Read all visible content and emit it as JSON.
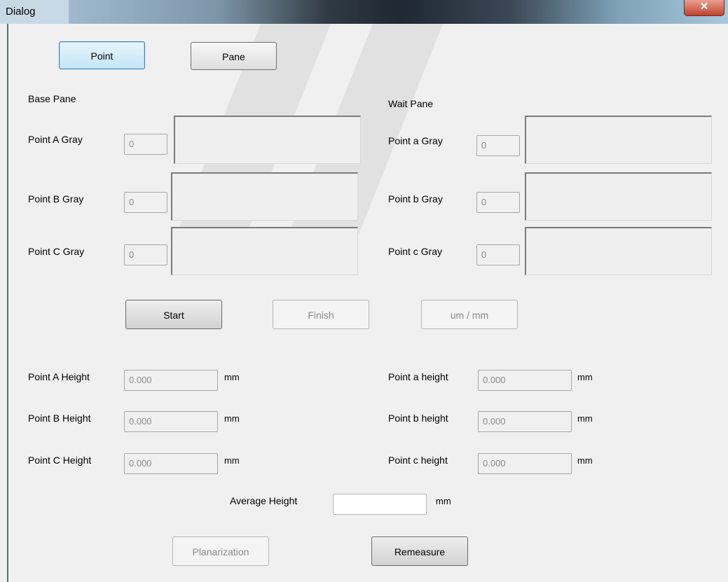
{
  "window": {
    "title": "Dialog",
    "close_glyph": "✕"
  },
  "mode_buttons": {
    "point": "Point",
    "pane": "Pane"
  },
  "base_pane": {
    "heading": "Base Pane",
    "rows": [
      {
        "label": "Point A Gray",
        "value": "0"
      },
      {
        "label": "Point B Gray",
        "value": "0"
      },
      {
        "label": "Point C Gray",
        "value": "0"
      }
    ]
  },
  "wait_pane": {
    "heading": "Wait Pane",
    "rows": [
      {
        "label": "Point a Gray",
        "value": "0"
      },
      {
        "label": "Point b Gray",
        "value": "0"
      },
      {
        "label": "Point c Gray",
        "value": "0"
      }
    ]
  },
  "actions": {
    "start": "Start",
    "finish": "Finish",
    "units": "um / mm"
  },
  "heights_left": [
    {
      "label": "Point A Height",
      "value": "0.000",
      "unit": "mm"
    },
    {
      "label": "Point B Height",
      "value": "0.000",
      "unit": "mm"
    },
    {
      "label": "Point C Height",
      "value": "0.000",
      "unit": "mm"
    }
  ],
  "heights_right": [
    {
      "label": "Point a height",
      "value": "0.000",
      "unit": "mm"
    },
    {
      "label": "Point b height",
      "value": "0.000",
      "unit": "mm"
    },
    {
      "label": "Point c height",
      "value": "0.000",
      "unit": "mm"
    }
  ],
  "average": {
    "label": "Average Height",
    "value": "",
    "unit": "mm"
  },
  "bottom_buttons": {
    "planarization": "Planarization",
    "remeasure": "Remeasure"
  },
  "colors": {
    "active_button": "#c4e5f6",
    "close_button": "#c0422f"
  }
}
